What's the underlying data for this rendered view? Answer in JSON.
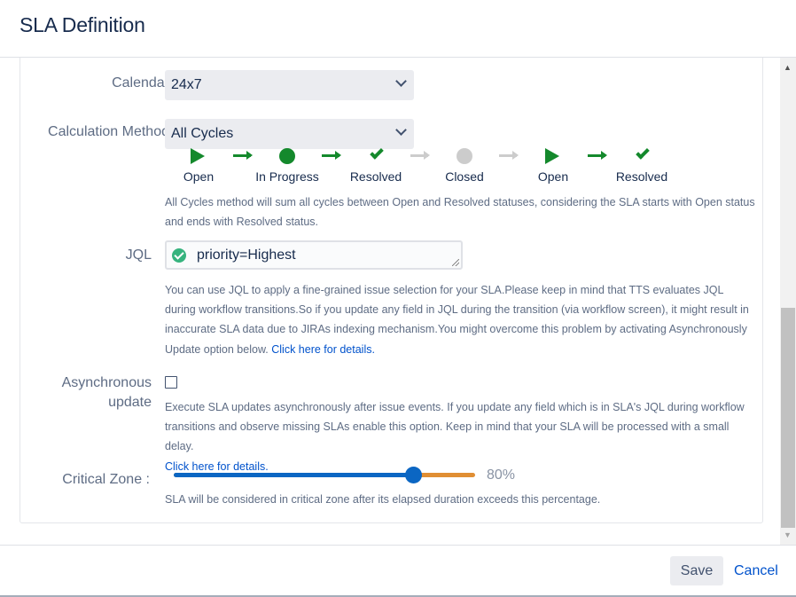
{
  "dialog": {
    "title": "SLA Definition"
  },
  "form": {
    "calendar": {
      "label": "Calendar",
      "value": "24x7"
    },
    "calculation_method": {
      "label": "Calculation Method",
      "value": "All Cycles"
    },
    "cycle_steps": [
      {
        "label": "Open",
        "icon": "play-icon",
        "color": "#14892c"
      },
      {
        "label": "In Progress",
        "icon": "circle-icon",
        "color": "#14892c"
      },
      {
        "label": "Resolved",
        "icon": "check-icon",
        "color": "#14892c"
      },
      {
        "label": "Closed",
        "icon": "circle-icon",
        "color": "#cccccc"
      },
      {
        "label": "Open",
        "icon": "play-icon",
        "color": "#14892c"
      },
      {
        "label": "Resolved",
        "icon": "check-icon",
        "color": "#14892c"
      }
    ],
    "cycle_arrows": [
      {
        "icon": "arrow-right-icon",
        "color": "#14892c"
      },
      {
        "icon": "arrow-right-icon",
        "color": "#14892c"
      },
      {
        "icon": "arrow-right-icon",
        "color": "#cccccc"
      },
      {
        "icon": "arrow-right-icon",
        "color": "#cccccc"
      },
      {
        "icon": "arrow-right-icon",
        "color": "#14892c"
      }
    ],
    "calculation_help": "All Cycles method will sum all cycles between Open and Resolved statuses, considering the SLA starts with Open status and ends with Resolved status.",
    "jql": {
      "label": "JQL",
      "value": "priority=Highest",
      "help": "You can use JQL to apply a fine-grained issue selection for your SLA.Please keep in mind that TTS evaluates JQL during workflow transitions.So if you update any field in JQL during the transition (via workflow screen), it might result in inaccurate SLA data due to JIRAs indexing mechanism.You might overcome this problem by activating Asynchronously Update option below.",
      "help_link": "Click here for details."
    },
    "async": {
      "label_line1": "Asynchronous",
      "label_line2": "update",
      "checked": false,
      "help": "Execute SLA updates asynchronously after issue events. If you update any field which is in SLA's JQL during workflow transitions and observe missing SLAs enable this option. Keep in mind that your SLA will be processed with a small delay.",
      "help_link": "Click here for details."
    },
    "critical_zone": {
      "label": "Critical Zone :",
      "value_percent": 80,
      "value_text": "80%",
      "help": "SLA will be considered in critical zone after its elapsed duration exceeds this percentage.",
      "colors": {
        "fill": "#0b66c3",
        "rest": "#e08e33"
      }
    }
  },
  "footer": {
    "save_label": "Save",
    "cancel_label": "Cancel"
  }
}
